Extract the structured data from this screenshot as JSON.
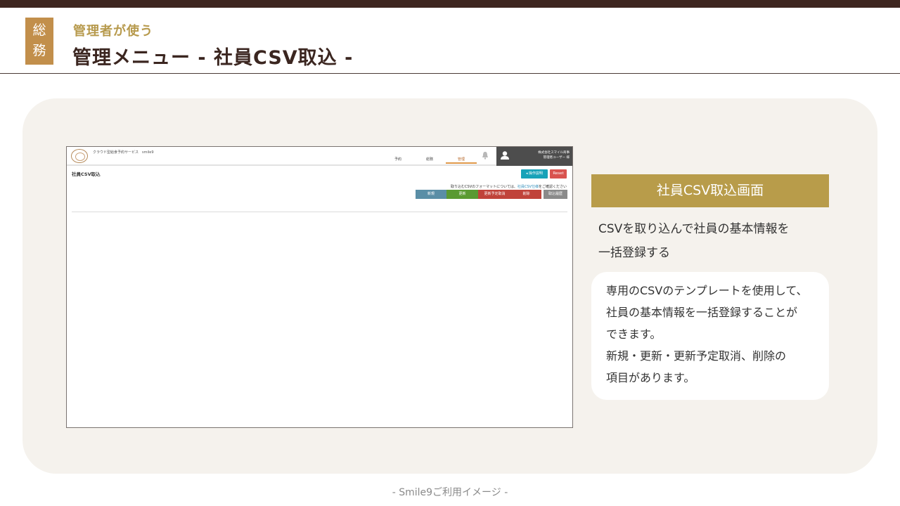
{
  "header": {
    "dept_tag": [
      "総",
      "務"
    ],
    "subtitle": "管理者が使う",
    "title": "管理メニュー - 社員CSV取込 -"
  },
  "screen": {
    "service_name": "クラウド型給食予約サービス　smile9",
    "nav": [
      "予約",
      "総務",
      "管理"
    ],
    "active_nav": "管理",
    "company_lines": [
      "株式会社スマイル商事",
      "管理者ユーザー 様"
    ],
    "page_name": "社員CSV取込",
    "help_button": "操作説明",
    "reset_button": "Reset",
    "format_note_prefix": "取り込むCSVのフォーマットについては、",
    "format_note_link": "社員CSV仕様",
    "format_note_suffix": "をご確認ください",
    "actions": [
      {
        "label": "新規",
        "color": "#5a8ea6"
      },
      {
        "label": "更新",
        "color": "#5a9a32"
      },
      {
        "label": "更新予定取消",
        "color": "#c0433a"
      },
      {
        "label": "削除",
        "color": "#c0433a"
      },
      {
        "label": "取込履歴",
        "color": "#8a8a8a"
      }
    ]
  },
  "side": {
    "caption": "社員CSV取込画面",
    "summary_lines": [
      "CSVを取り込んで社員の基本情報を",
      "一括登録する"
    ],
    "detail_lines": [
      "専用のCSVのテンプレートを使用して、",
      "社員の基本情報を一括登録することが",
      "できます。",
      "新規・更新・更新予定取消、削除の",
      "項目があります。"
    ]
  },
  "footer": "- Smile9ご利用イメージ -",
  "colors": {
    "top_bar": "#3e2620",
    "dept_tag": "#c28f4b",
    "subtitle": "#b79a4d",
    "caption_bar": "#b89c4a",
    "panel": "#f5f2ed"
  }
}
